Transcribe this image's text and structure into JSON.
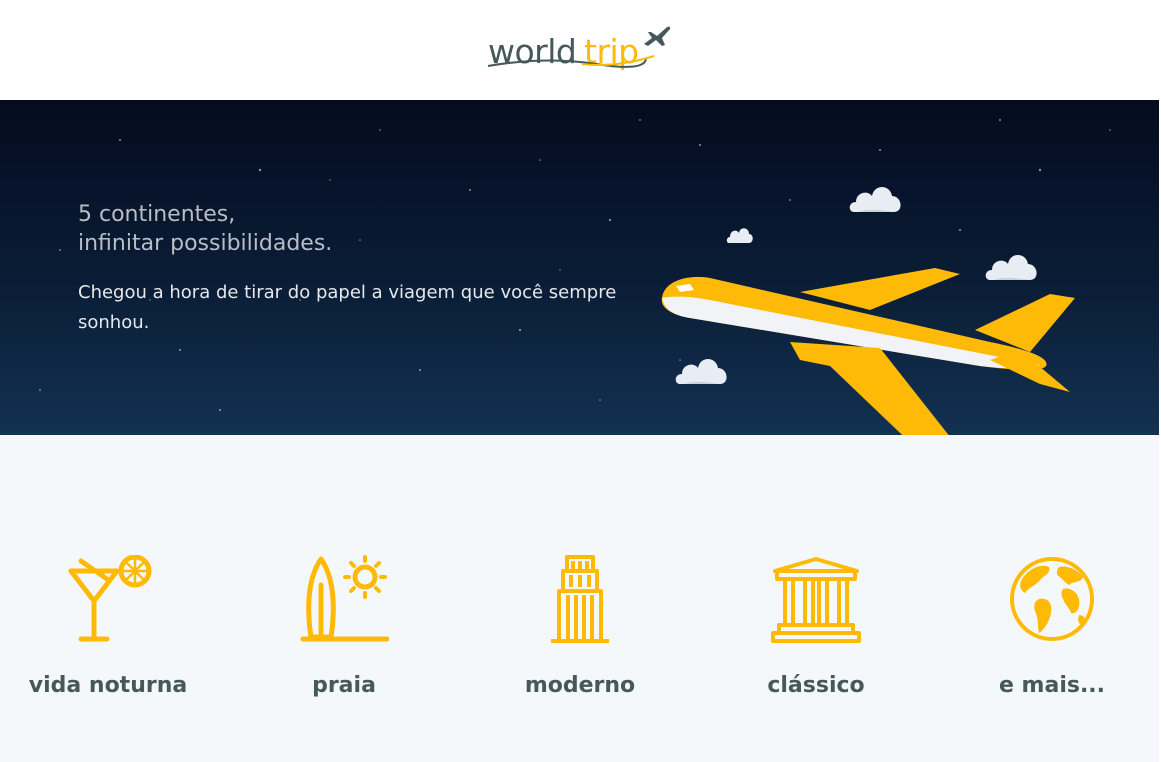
{
  "header": {
    "logo": {
      "world": "world",
      "trip": "trip"
    }
  },
  "banner": {
    "title": "5 continentes,\ninfinitar possibilidades.",
    "subtitle": "Chegou a hora de tirar do papel a viagem que você sempre sonhou."
  },
  "types": [
    {
      "label": "vida noturna",
      "icon": "cocktail-icon"
    },
    {
      "label": "praia",
      "icon": "surf-beach-icon"
    },
    {
      "label": "moderno",
      "icon": "skyscraper-icon"
    },
    {
      "label": "clássico",
      "icon": "museum-icon"
    },
    {
      "label": "e mais...",
      "icon": "globe-icon"
    }
  ],
  "colors": {
    "accent": "#FFBA08",
    "text": "#47585B",
    "banner_dark": "#040b1f",
    "section_bg": "#F5F8FA"
  }
}
